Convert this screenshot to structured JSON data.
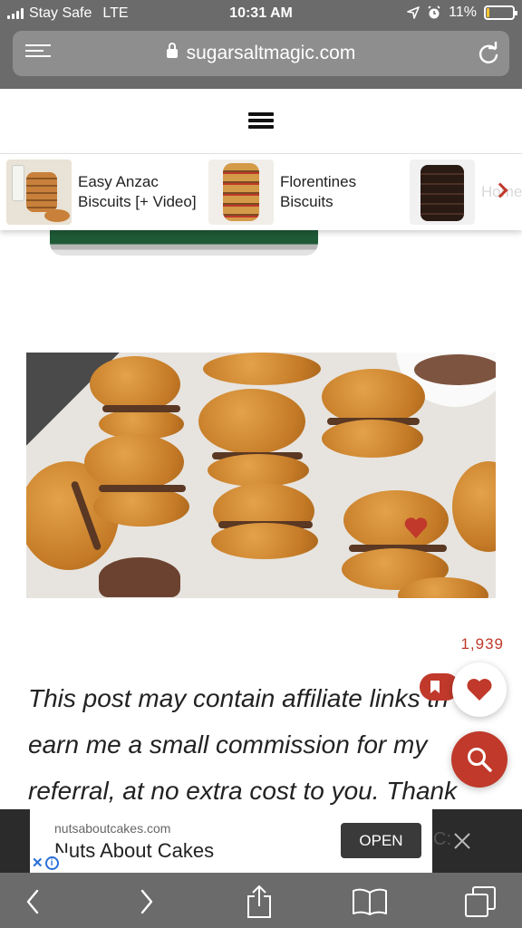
{
  "status_bar": {
    "carrier": "Stay Safe",
    "network": "LTE",
    "time": "10:31 AM",
    "battery_percent": "11%",
    "battery_level": 0.11,
    "battery_color": "#f4c430",
    "icons": [
      "signal-icon",
      "location-arrow-icon",
      "alarm-icon",
      "battery-icon"
    ]
  },
  "browser": {
    "url": "sugarsaltmagic.com",
    "icons": [
      "reader-view-icon",
      "lock-icon",
      "reload-icon"
    ]
  },
  "site_header": {
    "icons": [
      "hamburger-menu-icon"
    ]
  },
  "related_posts": [
    {
      "title": "Easy Anzac Biscuits [+ Video]",
      "thumb": "anzac-biscuits-thumbnail"
    },
    {
      "title": "Florentines Biscuits",
      "thumb": "florentines-thumbnail"
    },
    {
      "title": "Home Choc",
      "thumb": "chocolate-biscuits-thumbnail"
    }
  ],
  "article": {
    "hero_image": "anzac-biscuit-sandwiches-with-chocolate-filling",
    "share_count": "1,939",
    "disclosure_lines": [
      "This post may contain affiliate links th",
      "earn me a small commission for my",
      "referral, at no extra cost to you. Thank"
    ]
  },
  "floating_buttons": {
    "accent_color": "#c0392b",
    "icons": [
      "bookmark-icon",
      "heart-icon",
      "search-icon"
    ]
  },
  "ad": {
    "domain": "nutsaboutcakes.com",
    "name": "Nuts About Cakes",
    "cta": "OPEN",
    "hidden_text_fragment": "C:",
    "icons": [
      "ad-close-icon",
      "adchoices-x-icon",
      "adchoices-info-icon"
    ]
  },
  "toolbar": {
    "icons": [
      "back-icon",
      "forward-icon",
      "share-icon",
      "bookmarks-icon",
      "tabs-icon"
    ]
  }
}
